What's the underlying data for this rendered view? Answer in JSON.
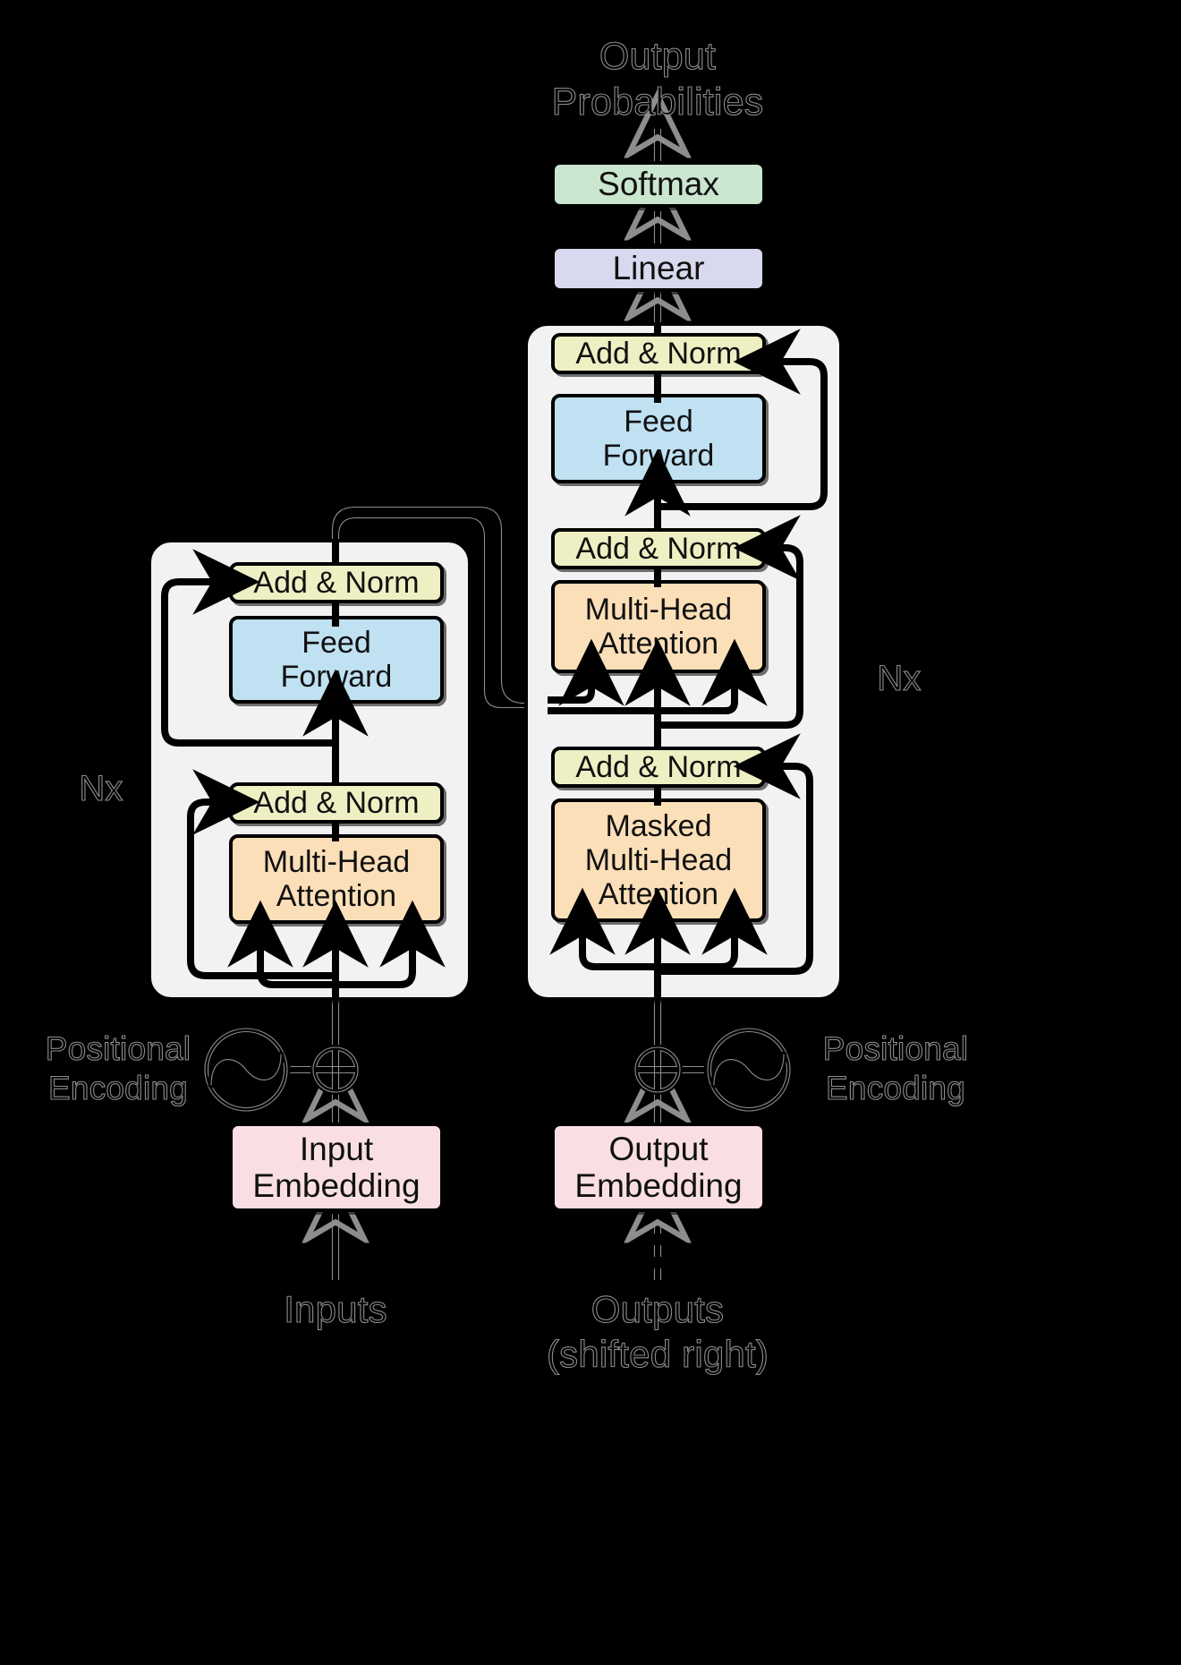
{
  "diagram": {
    "title": "Transformer model architecture",
    "type": "block-diagram",
    "background_color": "#000000",
    "colors": {
      "add_norm": "#eef0c4",
      "feed_forward": "#bfe1f2",
      "attention": "#fbdfb8",
      "linear": "#d8d8ee",
      "softmax": "#cbe6cf",
      "embedding": "#f9dfe3",
      "panel": "#f2f2f2",
      "stroke": "#000000",
      "outline_text": "#8d8d8d"
    }
  },
  "top": {
    "output_probabilities": "Output\nProbabilities",
    "softmax": "Softmax",
    "linear": "Linear"
  },
  "encoder": {
    "repeat_label": "Nx",
    "blocks": [
      {
        "id": "enc-add-norm-2",
        "label": "Add & Norm",
        "kind": "add_norm"
      },
      {
        "id": "enc-feed-forward",
        "label": "Feed\nForward",
        "kind": "feed_forward"
      },
      {
        "id": "enc-add-norm-1",
        "label": "Add & Norm",
        "kind": "add_norm"
      },
      {
        "id": "enc-multi-head-attention",
        "label": "Multi-Head\nAttention",
        "kind": "attention"
      }
    ],
    "positional_encoding": "Positional\nEncoding",
    "sum_symbol": "⊕",
    "embedding": "Input\nEmbedding",
    "source": "Inputs"
  },
  "decoder": {
    "repeat_label": "Nx",
    "blocks": [
      {
        "id": "dec-add-norm-3",
        "label": "Add & Norm",
        "kind": "add_norm"
      },
      {
        "id": "dec-feed-forward",
        "label": "Feed\nForward",
        "kind": "feed_forward"
      },
      {
        "id": "dec-add-norm-2",
        "label": "Add & Norm",
        "kind": "add_norm"
      },
      {
        "id": "dec-multi-head-attention",
        "label": "Multi-Head\nAttention",
        "kind": "attention"
      },
      {
        "id": "dec-add-norm-1",
        "label": "Add & Norm",
        "kind": "add_norm"
      },
      {
        "id": "dec-masked-multi-head-attention",
        "label": "Masked\nMulti-Head\nAttention",
        "kind": "attention"
      }
    ],
    "positional_encoding": "Positional\nEncoding",
    "sum_symbol": "⊕",
    "embedding": "Output\nEmbedding",
    "source": "Outputs\n(shifted right)"
  }
}
